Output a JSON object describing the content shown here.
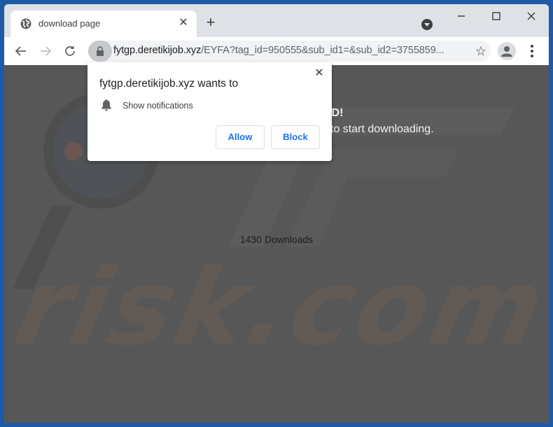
{
  "browser": {
    "tab": {
      "title": "download page",
      "favicon": "globe-icon",
      "close_icon": "close-icon"
    },
    "new_tab_icon": "plus-icon",
    "tab_search_icon": "tab-search-icon",
    "window_controls": {
      "minimize": "—",
      "maximize": "☐",
      "close": "✕"
    },
    "toolbar": {
      "back_icon": "arrow-left-icon",
      "forward_icon": "arrow-right-icon",
      "reload_icon": "reload-icon",
      "lock_icon": "lock-icon",
      "url_host": "fytgp.deretikijob.xyz",
      "url_rest": "/EYFA?tag_id=950555&sub_id1=&sub_id2=3755859...",
      "star_icon": "☆",
      "profile_icon": "person-icon",
      "menu_icon": "kebab-menu-icon"
    }
  },
  "page": {
    "headline_partial": "AD!",
    "subline_partial": "to start downloading.",
    "downloads_text": "1430 Downloads",
    "watermark": "risk.com"
  },
  "permission_popup": {
    "title": "fytgp.deretikijob.xyz wants to",
    "permission_label": "Show notifications",
    "permission_icon": "bell-icon",
    "allow_label": "Allow",
    "block_label": "Block",
    "close_glyph": "✕"
  },
  "colors": {
    "window_frame": "#1f5aa6",
    "tabstrip": "#dee1e6",
    "page_overlay": "#575757",
    "button_text": "#1a73e8"
  }
}
